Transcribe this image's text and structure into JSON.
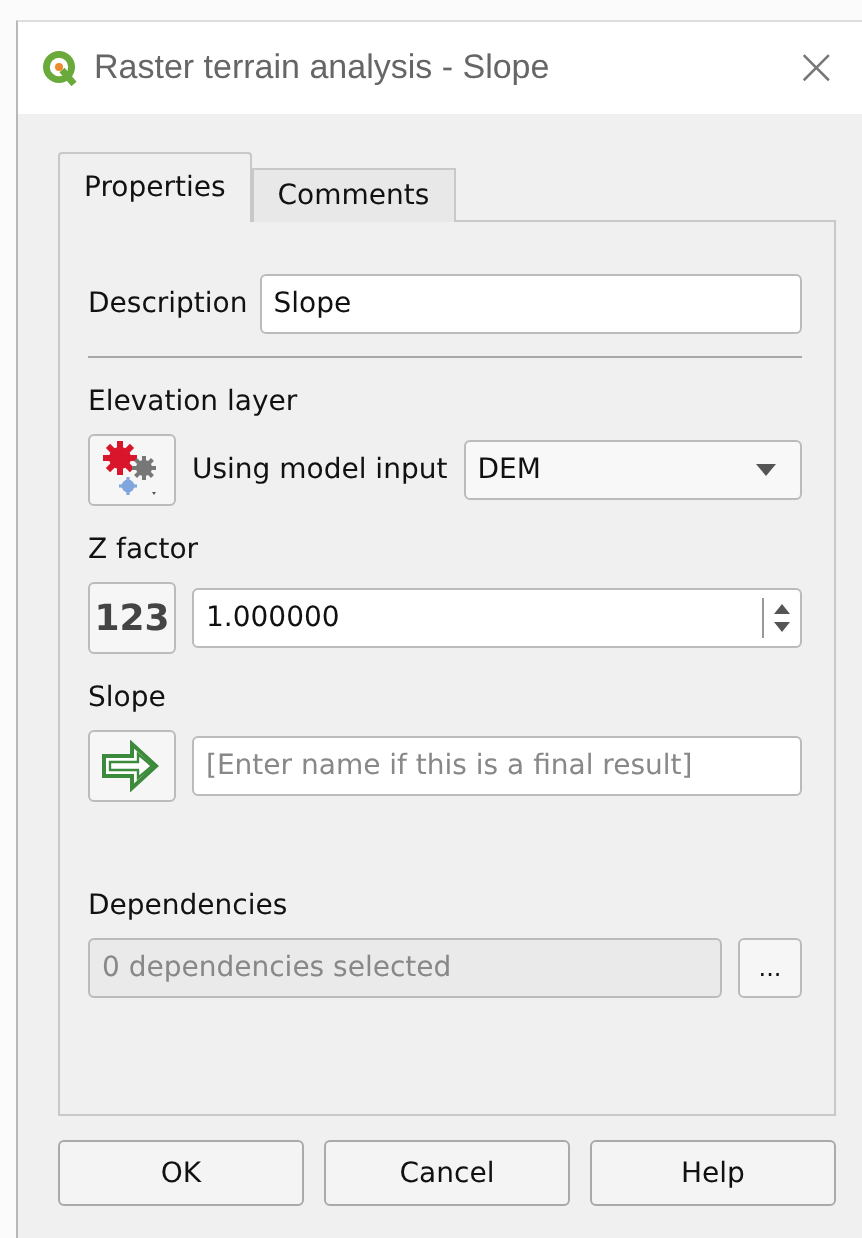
{
  "window": {
    "title": "Raster terrain analysis - Slope",
    "close": "×"
  },
  "tabs": [
    {
      "label": "Properties",
      "selected": true
    },
    {
      "label": "Comments",
      "selected": false
    }
  ],
  "description": {
    "label": "Description",
    "value": "Slope"
  },
  "parameters": [
    {
      "kind": "model-input",
      "label": "Elevation layer",
      "mode_text": "Using model input",
      "value": "DEM"
    },
    {
      "kind": "number",
      "label": "Z factor",
      "source_text": "123",
      "value": "1.000000"
    },
    {
      "kind": "output",
      "label": "Slope",
      "placeholder": "[Enter name if this is a final result]"
    }
  ],
  "dependencies": {
    "label": "Dependencies",
    "value": "0 dependencies selected",
    "disabled": true,
    "button": "..."
  },
  "buttons": [
    "OK",
    "Cancel",
    "Help"
  ]
}
